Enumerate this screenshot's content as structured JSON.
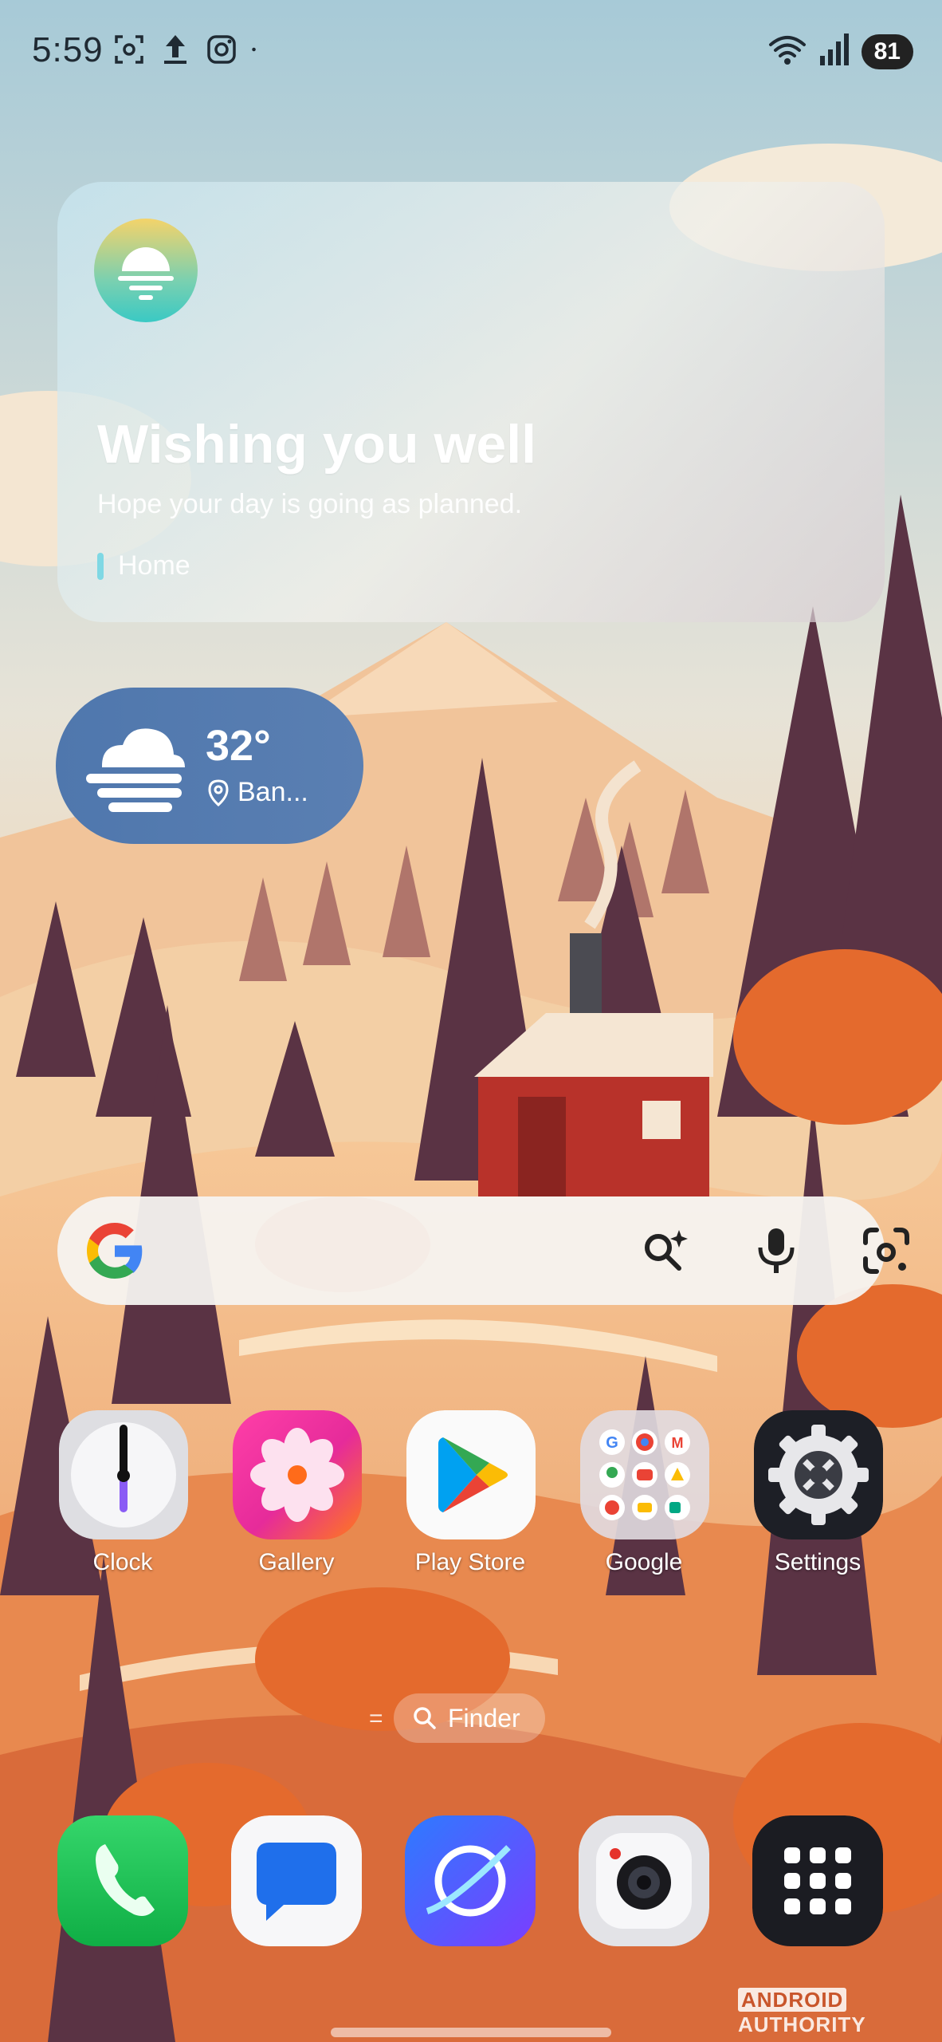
{
  "status_bar": {
    "time": "5:59",
    "battery": "81",
    "left_icons": [
      "screenshot-icon",
      "upload-icon",
      "instagram-icon",
      "notification-dot-icon"
    ],
    "right_icons": [
      "wifi-icon",
      "signal-icon"
    ]
  },
  "greeting_widget": {
    "title": "Wishing you well",
    "subtitle": "Hope your day is going as planned.",
    "tag": "Home"
  },
  "weather_widget": {
    "temperature": "32°",
    "location": "Ban..."
  },
  "search_bar": {
    "icons": [
      "google-logo",
      "ai-lens-search-icon",
      "mic-icon",
      "lens-camera-icon"
    ]
  },
  "apps": [
    {
      "label": "Clock",
      "icon": "clock-icon"
    },
    {
      "label": "Gallery",
      "icon": "gallery-icon"
    },
    {
      "label": "Play Store",
      "icon": "play-store-icon"
    },
    {
      "label": "Google",
      "icon": "google-folder-icon"
    },
    {
      "label": "Settings",
      "icon": "settings-icon"
    }
  ],
  "finder": {
    "label": "Finder"
  },
  "dock": [
    {
      "icon": "phone-icon"
    },
    {
      "icon": "messages-icon"
    },
    {
      "icon": "browser-icon"
    },
    {
      "icon": "camera-icon"
    },
    {
      "icon": "app-drawer-icon"
    }
  ],
  "watermark": {
    "brand": "ANDROID",
    "suffix": "AUTHORITY"
  },
  "colors": {
    "weather_pill": "#4f77ad",
    "sky": "#a9ccd8",
    "search_bar": "#f5f3f0"
  }
}
